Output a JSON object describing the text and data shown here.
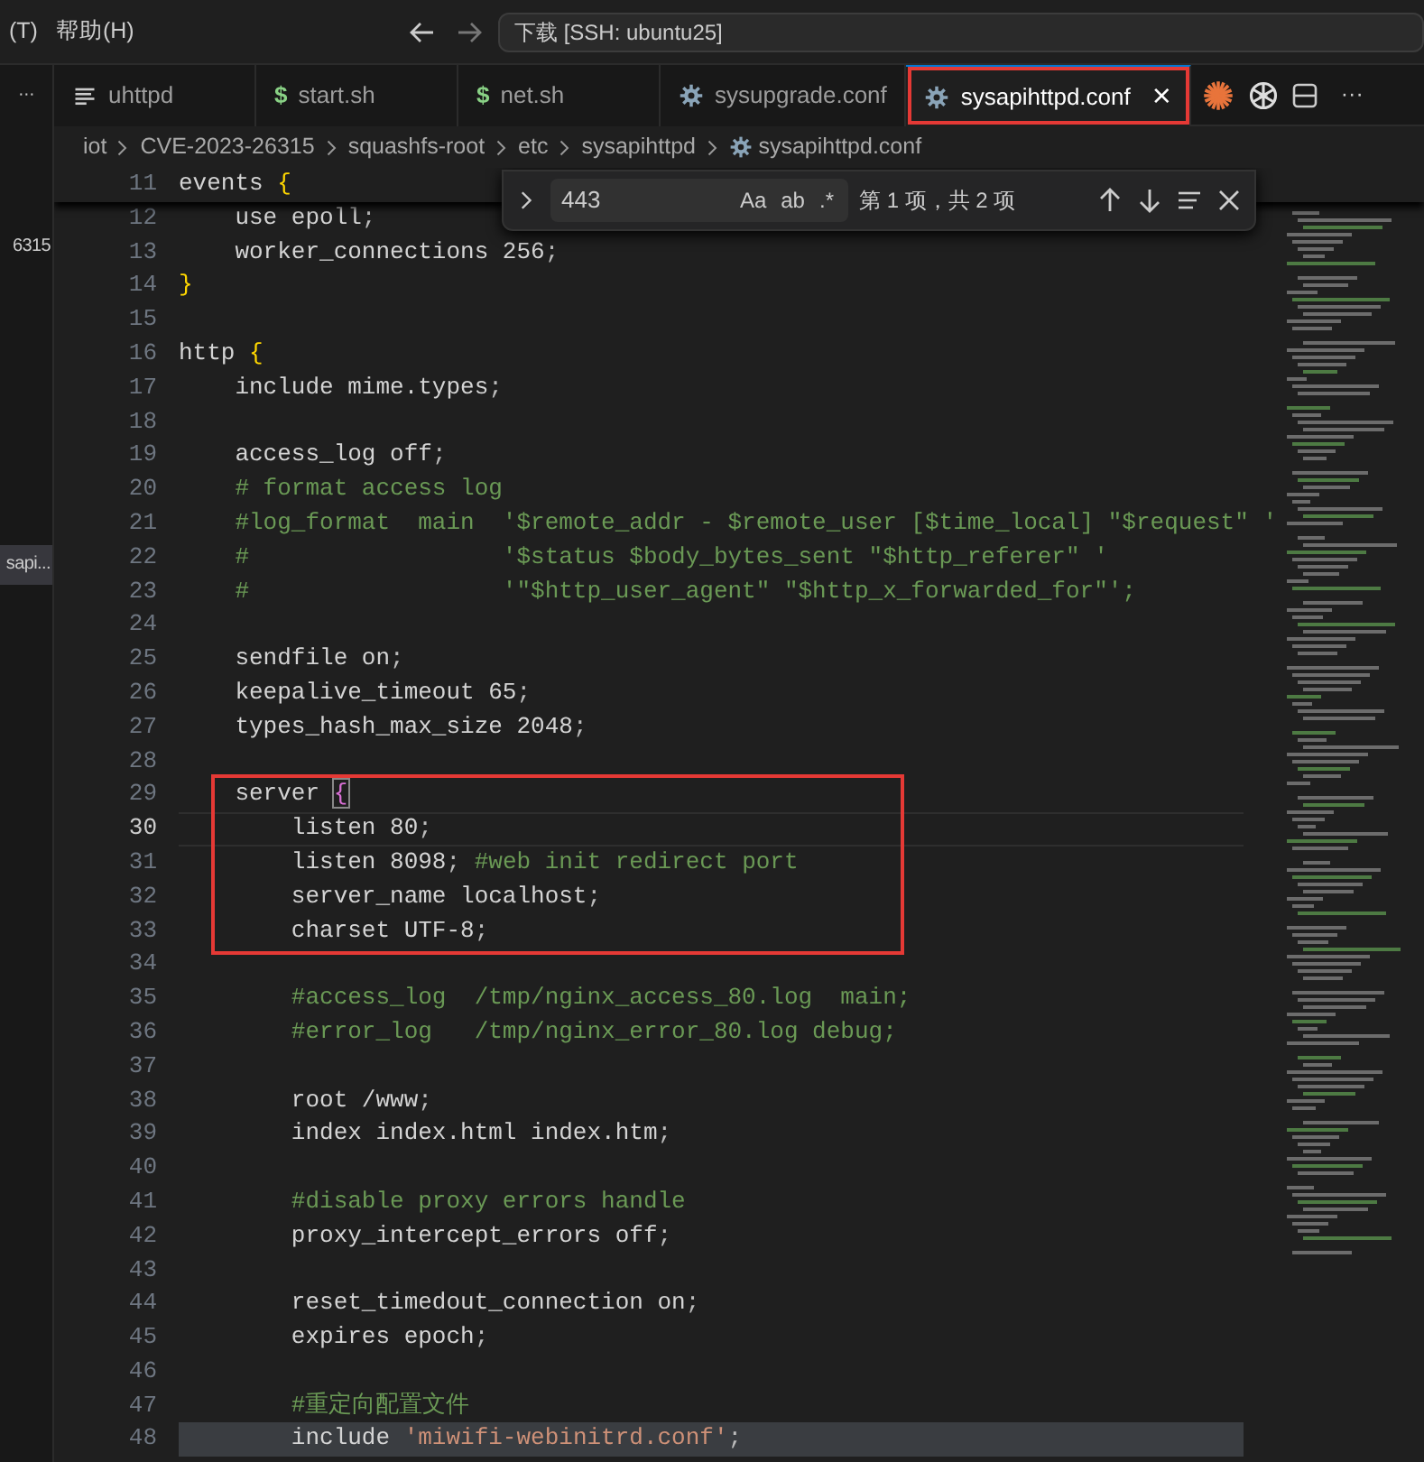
{
  "title_bar": {
    "menus": [
      {
        "label": "(T)"
      },
      {
        "label": "帮助(H)"
      }
    ],
    "command_center": "下载 [SSH: ubuntu25]"
  },
  "explorer": {
    "items": [
      {
        "label": "6315",
        "selected": false
      },
      {
        "label": "sapi...",
        "selected": true
      }
    ]
  },
  "overflow_label": "···",
  "tabs": [
    {
      "label": "uhttpd",
      "kind": "text",
      "selected": false,
      "boxed": false
    },
    {
      "label": "start.sh",
      "kind": "shell",
      "icon_text": "$",
      "selected": false,
      "boxed": false
    },
    {
      "label": "net.sh",
      "kind": "shell",
      "icon_text": "$",
      "selected": false,
      "boxed": false
    },
    {
      "label": "sysupgrade.conf",
      "kind": "config",
      "selected": false,
      "boxed": false
    },
    {
      "label": "sysapihttpd.conf",
      "kind": "config",
      "selected": true,
      "boxed": true,
      "close": "×"
    }
  ],
  "tab_actions": [
    {
      "kind": "burst"
    },
    {
      "kind": "knot"
    },
    {
      "kind": "split"
    },
    {
      "kind": "more",
      "text": "···"
    }
  ],
  "breadcrumb": [
    {
      "label": "iot",
      "kind": "folder"
    },
    {
      "label": "CVE-2023-26315",
      "kind": "folder"
    },
    {
      "label": "squashfs-root",
      "kind": "folder"
    },
    {
      "label": "etc",
      "kind": "folder"
    },
    {
      "label": "sysapihttpd",
      "kind": "folder"
    },
    {
      "label": "sysapihttpd.conf",
      "kind": "config"
    }
  ],
  "find_widget": {
    "query": "443",
    "options": [
      "Aa",
      "ab",
      ".*"
    ],
    "result": "第 1 项，共 2 项"
  },
  "lines": [
    {
      "n": "11",
      "sticky": true,
      "segs": [
        {
          "text": "events ",
          "kind": "plain"
        },
        {
          "text": "{",
          "kind": "brace"
        }
      ]
    },
    {
      "n": "12",
      "segs": [
        {
          "text": "    use epoll",
          "kind": "plain"
        },
        {
          "text": ";",
          "kind": "punct"
        }
      ]
    },
    {
      "n": "13",
      "segs": [
        {
          "text": "    worker_connections 256",
          "kind": "plain"
        },
        {
          "text": ";",
          "kind": "punct"
        }
      ]
    },
    {
      "n": "14",
      "segs": [
        {
          "text": "}",
          "kind": "brace"
        }
      ]
    },
    {
      "n": "15"
    },
    {
      "n": "16",
      "segs": [
        {
          "text": "http ",
          "kind": "plain"
        },
        {
          "text": "{",
          "kind": "brace"
        }
      ]
    },
    {
      "n": "17",
      "segs": [
        {
          "text": "    include mime.types",
          "kind": "plain"
        },
        {
          "text": ";",
          "kind": "punct"
        }
      ]
    },
    {
      "n": "18"
    },
    {
      "n": "19",
      "segs": [
        {
          "text": "    access_log off",
          "kind": "plain"
        },
        {
          "text": ";",
          "kind": "punct"
        }
      ]
    },
    {
      "n": "20",
      "segs": [
        {
          "text": "    # format access log",
          "kind": "comment"
        }
      ]
    },
    {
      "n": "21",
      "segs": [
        {
          "text": "    #log_format  main  '$remote_addr - $remote_user [$time_local] \"$request\" '",
          "kind": "comment"
        }
      ]
    },
    {
      "n": "22",
      "segs": [
        {
          "text": "    #                  '$status $body_bytes_sent \"$http_referer\" '",
          "kind": "comment"
        }
      ]
    },
    {
      "n": "23",
      "segs": [
        {
          "text": "    #                  '\"$http_user_agent\" \"$http_x_forwarded_for\"';",
          "kind": "comment"
        }
      ]
    },
    {
      "n": "24"
    },
    {
      "n": "25",
      "segs": [
        {
          "text": "    sendfile on",
          "kind": "plain"
        },
        {
          "text": ";",
          "kind": "punct"
        }
      ]
    },
    {
      "n": "26",
      "segs": [
        {
          "text": "    keepalive_timeout 65",
          "kind": "plain"
        },
        {
          "text": ";",
          "kind": "punct"
        }
      ]
    },
    {
      "n": "27",
      "segs": [
        {
          "text": "    types_hash_max_size 2048",
          "kind": "plain"
        },
        {
          "text": ";",
          "kind": "punct"
        }
      ]
    },
    {
      "n": "28"
    },
    {
      "n": "29",
      "boxed": true,
      "segs": [
        {
          "text": "    server ",
          "kind": "plain"
        },
        {
          "text": "{",
          "kind": "brace-match"
        }
      ]
    },
    {
      "n": "30",
      "boxed": true,
      "current": true,
      "segs": [
        {
          "text": "        listen 80",
          "kind": "plain"
        },
        {
          "text": ";",
          "kind": "punct"
        }
      ]
    },
    {
      "n": "31",
      "boxed": true,
      "segs": [
        {
          "text": "        listen 8098",
          "kind": "plain"
        },
        {
          "text": "; ",
          "kind": "punct"
        },
        {
          "text": "#web init redirect port",
          "kind": "comment"
        }
      ]
    },
    {
      "n": "32",
      "boxed": true,
      "segs": [
        {
          "text": "        server_name localhost",
          "kind": "plain"
        },
        {
          "text": ";",
          "kind": "punct"
        }
      ]
    },
    {
      "n": "33",
      "boxed": true,
      "segs": [
        {
          "text": "        charset UTF-8",
          "kind": "plain"
        },
        {
          "text": ";",
          "kind": "punct"
        }
      ]
    },
    {
      "n": "34"
    },
    {
      "n": "35",
      "segs": [
        {
          "text": "        #access_log  /tmp/nginx_access_80.log  main;",
          "kind": "comment"
        }
      ]
    },
    {
      "n": "36",
      "segs": [
        {
          "text": "        #error_log   /tmp/nginx_error_80.log debug;",
          "kind": "comment"
        }
      ]
    },
    {
      "n": "37"
    },
    {
      "n": "38",
      "segs": [
        {
          "text": "        root /www",
          "kind": "plain"
        },
        {
          "text": ";",
          "kind": "punct"
        }
      ]
    },
    {
      "n": "39",
      "segs": [
        {
          "text": "        index index.html index.htm",
          "kind": "plain"
        },
        {
          "text": ";",
          "kind": "punct"
        }
      ]
    },
    {
      "n": "40"
    },
    {
      "n": "41",
      "segs": [
        {
          "text": "        #disable proxy errors handle",
          "kind": "comment"
        }
      ]
    },
    {
      "n": "42",
      "segs": [
        {
          "text": "        proxy_intercept_errors off",
          "kind": "plain"
        },
        {
          "text": ";",
          "kind": "punct"
        }
      ]
    },
    {
      "n": "43"
    },
    {
      "n": "44",
      "segs": [
        {
          "text": "        reset_timedout_connection on",
          "kind": "plain"
        },
        {
          "text": ";",
          "kind": "punct"
        }
      ]
    },
    {
      "n": "45",
      "segs": [
        {
          "text": "        expires epoch",
          "kind": "plain"
        },
        {
          "text": ";",
          "kind": "punct"
        }
      ]
    },
    {
      "n": "46"
    },
    {
      "n": "47",
      "segs": [
        {
          "text": "        #重定向配置文件",
          "kind": "comment"
        }
      ]
    },
    {
      "n": "48",
      "highlighted": true,
      "segs": [
        {
          "text": "        include ",
          "kind": "plain"
        },
        {
          "text": "'miwifi-webinitrd.conf'",
          "kind": "string"
        },
        {
          "text": ";",
          "kind": "punct"
        }
      ]
    }
  ]
}
